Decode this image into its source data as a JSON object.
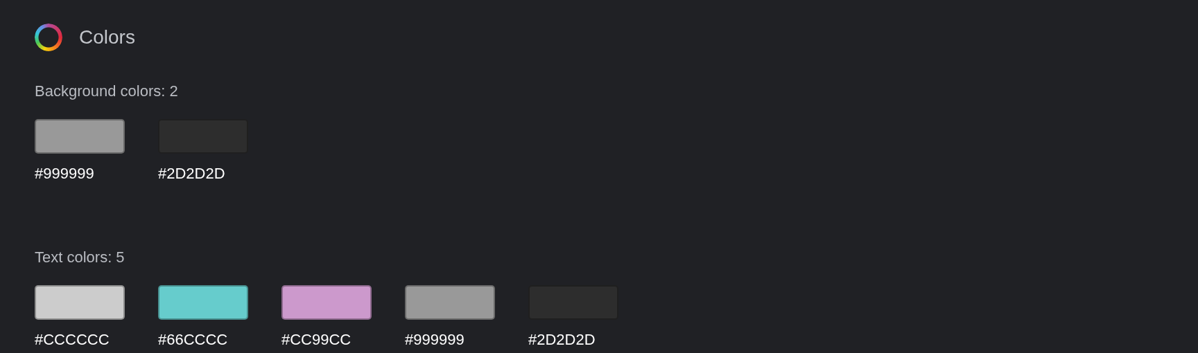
{
  "title": "Colors",
  "sections": [
    {
      "heading": "Background colors: 2",
      "swatches": [
        {
          "color": "#999999",
          "label": "#999999"
        },
        {
          "color": "#2d2d2d",
          "label": "#2D2D2D"
        }
      ]
    },
    {
      "heading": "Text colors: 5",
      "swatches": [
        {
          "color": "#cccccc",
          "label": "#CCCCCC"
        },
        {
          "color": "#66cccc",
          "label": "#66CCCC"
        },
        {
          "color": "#cc99cc",
          "label": "#CC99CC"
        },
        {
          "color": "#999999",
          "label": "#999999"
        },
        {
          "color": "#2d2d2d",
          "label": "#2D2D2D"
        }
      ]
    }
  ]
}
